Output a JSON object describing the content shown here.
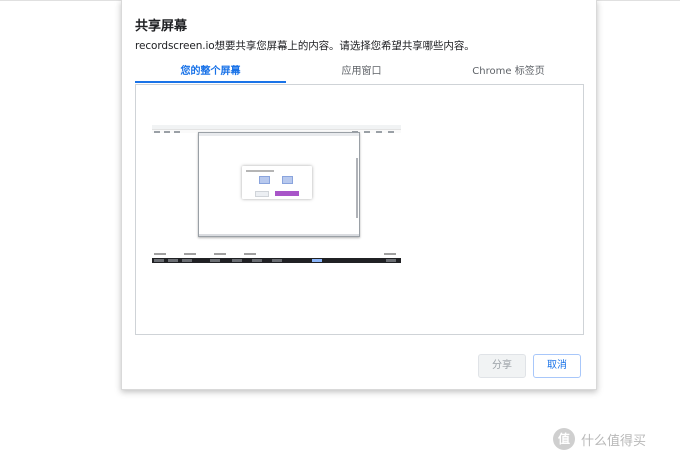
{
  "dialog": {
    "title": "共享屏幕",
    "subtitle": "recordscreen.io想要共享您屏幕上的内容。请选择您希望共享哪些内容。",
    "tabs": [
      {
        "label": "您的整个屏幕",
        "active": true
      },
      {
        "label": "应用窗口",
        "active": false
      },
      {
        "label": "Chrome 标签页",
        "active": false
      }
    ],
    "buttons": {
      "share": "分享",
      "cancel": "取消"
    }
  },
  "watermark": {
    "badge": "值",
    "text": "什么值得买"
  },
  "colors": {
    "accent": "#1a73e8",
    "thumbnail_modal_button": "#a855c8",
    "taskbar": "#202124"
  }
}
